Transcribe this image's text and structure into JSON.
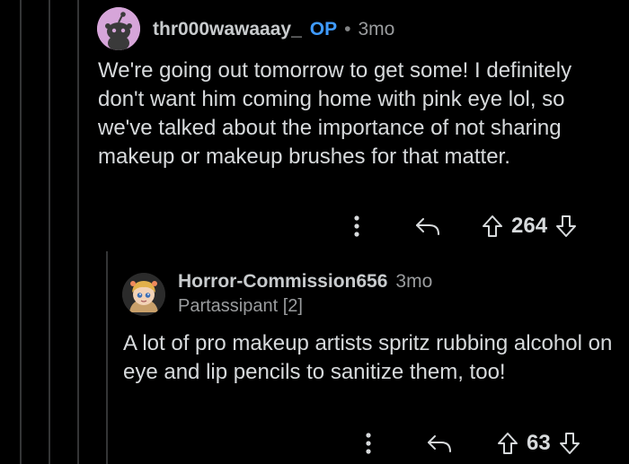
{
  "colors": {
    "background": "#000000",
    "text": "#d7dadc",
    "muted": "#9a9c9e",
    "op_badge": "#3f9bff",
    "thread_line": "#343536",
    "avatar1_bg": "#d6a5d9"
  },
  "comments": [
    {
      "username": "thr000wawaaay_",
      "op_badge": "OP",
      "separator": "•",
      "time": "3mo",
      "body": "We're going out tomorrow to get some! I definitely don't want him coming home with pink eye lol, so we've talked about the importance of not sharing makeup or makeup brushes for that matter.",
      "score": "264",
      "avatar_icon": "snoo-avatar-icon"
    },
    {
      "username": "Horror-Commission656",
      "time": "3mo",
      "flair": "Partassipant [2]",
      "body": "A lot of pro makeup artists spritz rubbing alcohol on eye and lip pencils to sanitize them, too!",
      "score": "63",
      "avatar_icon": "character-avatar-icon"
    }
  ],
  "icons": {
    "more": "more-options-icon",
    "reply": "reply-icon",
    "upvote": "upvote-icon",
    "downvote": "downvote-icon"
  }
}
